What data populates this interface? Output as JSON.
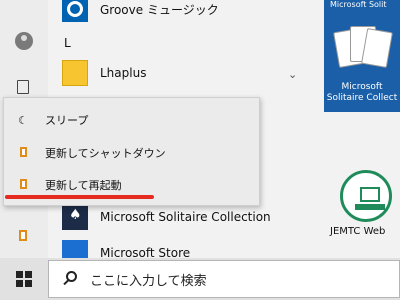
{
  "applist": {
    "items": [
      {
        "label": "Groove ミュージック"
      },
      {
        "label": "Lhaplus"
      },
      {
        "label": "Microsoft Solitaire Collection"
      },
      {
        "label": "Microsoft Store"
      }
    ],
    "section_letter": "L"
  },
  "power_menu": {
    "items": [
      {
        "label": "スリープ",
        "icon": "moon-icon"
      },
      {
        "label": "更新してシャットダウン",
        "icon": "power-icon"
      },
      {
        "label": "更新して再起動",
        "icon": "power-icon"
      }
    ],
    "highlight_color": "#e52a1f"
  },
  "tiles": {
    "solitaire_top_label": "Microsoft Solit",
    "solitaire_label_line1": "Microsoft",
    "solitaire_label_line2": "Solitaire Collect",
    "jemtc_label": "JEMTC Web"
  },
  "taskbar": {
    "search_placeholder": "ここに入力して検索"
  }
}
